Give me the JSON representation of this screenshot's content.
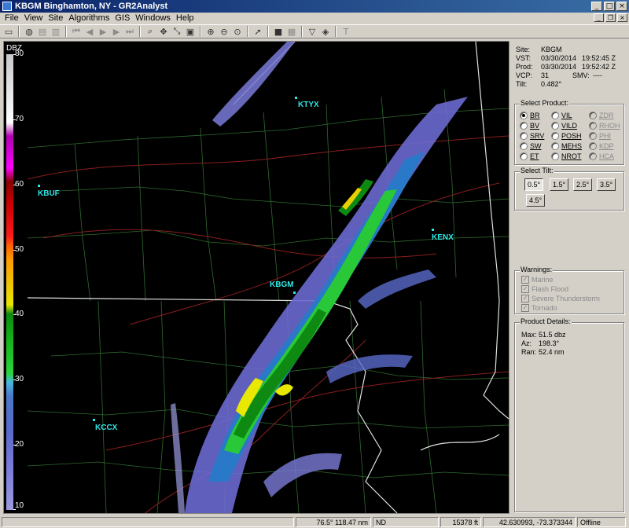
{
  "window": {
    "title": "KBGM Binghamton, NY - GR2Analyst"
  },
  "menu": [
    "File",
    "View",
    "Site",
    "Algorithms",
    "GIS",
    "Windows",
    "Help"
  ],
  "colorbar": {
    "unit": "DBZ",
    "ticks": [
      "80",
      "70",
      "60",
      "50",
      "40",
      "30",
      "20",
      "10"
    ]
  },
  "sites": [
    {
      "id": "KTYX"
    },
    {
      "id": "KBUF"
    },
    {
      "id": "KENX"
    },
    {
      "id": "KBGM"
    },
    {
      "id": "KCCX"
    }
  ],
  "info": {
    "site_label": "Site:",
    "site_value": "KBGM",
    "vst_label": "VST:",
    "vst_date": "03/30/2014",
    "vst_time": "19:52:45 Z",
    "prod_label": "Prod:",
    "prod_date": "03/30/2014",
    "prod_time": "19:52:42 Z",
    "vcp_label": "VCP:",
    "vcp_value": "31",
    "smv_label": "SMV:",
    "smv_value": "----",
    "tilt_label": "Tilt:",
    "tilt_value": "0.482°"
  },
  "select_product": {
    "label": "Select Product:",
    "items": [
      {
        "label": "BR",
        "selected": true,
        "enabled": true
      },
      {
        "label": "VIL",
        "selected": false,
        "enabled": true
      },
      {
        "label": "ZDR",
        "selected": false,
        "enabled": false
      },
      {
        "label": "BV",
        "selected": false,
        "enabled": true
      },
      {
        "label": "VILD",
        "selected": false,
        "enabled": true
      },
      {
        "label": "RHOH",
        "selected": false,
        "enabled": false
      },
      {
        "label": "SRV",
        "selected": false,
        "enabled": true
      },
      {
        "label": "POSH",
        "selected": false,
        "enabled": true
      },
      {
        "label": "PHI",
        "selected": false,
        "enabled": false
      },
      {
        "label": "SW",
        "selected": false,
        "enabled": true
      },
      {
        "label": "MEHS",
        "selected": false,
        "enabled": true
      },
      {
        "label": "KDP",
        "selected": false,
        "enabled": false
      },
      {
        "label": "ET",
        "selected": false,
        "enabled": true
      },
      {
        "label": "NROT",
        "selected": false,
        "enabled": true
      },
      {
        "label": "HCA",
        "selected": false,
        "enabled": false
      }
    ]
  },
  "select_tilt": {
    "label": "Select Tilt:",
    "buttons": [
      "0.5°",
      "1.5°",
      "2.5°",
      "3.5°",
      "4.5°"
    ],
    "selected": "0.5°"
  },
  "warnings": {
    "label": "Warnings:",
    "items": [
      "Marine",
      "Flash Flood",
      "Severe Thunderstorm",
      "Tornado"
    ]
  },
  "product_details": {
    "label": "Product Details:",
    "max_label": "Max:",
    "max_value": "51.5 dbz",
    "az_label": "Az:",
    "az_value": "198.3°",
    "ran_label": "Ran:",
    "ran_value": "52.4 nm"
  },
  "status": {
    "azran": "76.5° 118.47 nm",
    "nd": "ND",
    "height": "15378 ft",
    "coords": "42.630993, -73.373344",
    "conn": "Offline"
  },
  "colors": {
    "title_start": "#0a246a",
    "title_end": "#3a6ea5",
    "site": "#2ee6e6",
    "map_bg": "#000000"
  }
}
